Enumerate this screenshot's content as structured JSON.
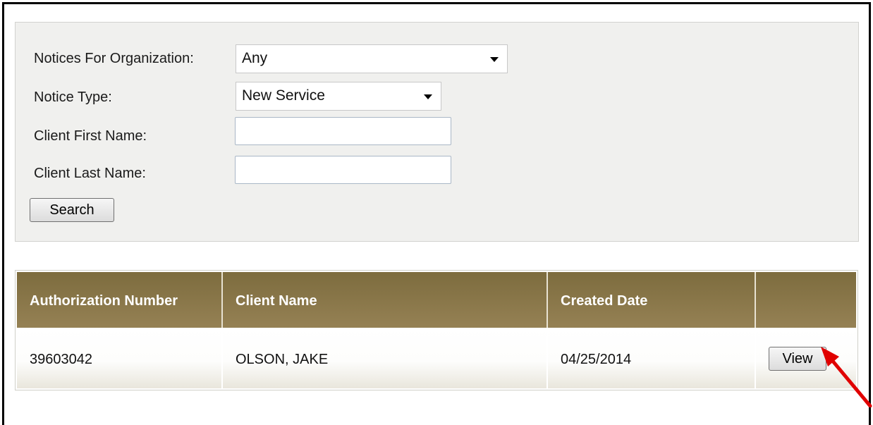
{
  "search_form": {
    "org_label": "Notices For Organization:",
    "org_value": "Any",
    "type_label": "Notice Type:",
    "type_value": "New Service",
    "first_name_label": "Client First Name:",
    "first_name_value": "",
    "last_name_label": "Client Last Name:",
    "last_name_value": "",
    "search_button": "Search"
  },
  "results_table": {
    "columns": [
      "Authorization Number",
      "Client Name",
      "Created Date",
      ""
    ],
    "rows": [
      {
        "authorization_number": "39603042",
        "client_name": "OLSON, JAKE",
        "created_date": "04/25/2014",
        "action_label": "View"
      }
    ]
  },
  "colors": {
    "header_bg": "#7d6c3e",
    "panel_bg": "#f0f0ee",
    "annotation_arrow": "#e00000"
  },
  "icons": [
    "dropdown-caret-icon",
    "annotation-arrow-icon"
  ]
}
